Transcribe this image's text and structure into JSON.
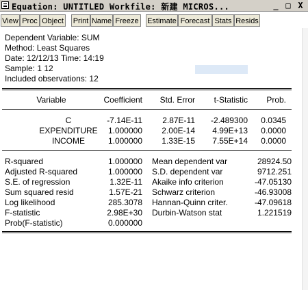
{
  "window": {
    "title": "Equation: UNTITLED   Workfile: 新建 MICROS...",
    "minimize": "_",
    "maximize": "□",
    "close": "X"
  },
  "toolbar": {
    "buttons": [
      "View",
      "Proc",
      "Object",
      "Print",
      "Name",
      "Freeze",
      "Estimate",
      "Forecast",
      "Stats",
      "Resids"
    ]
  },
  "header": {
    "dependent_variable": "Dependent Variable: SUM",
    "method": "Method: Least Squares",
    "date_time": "Date: 12/12/13   Time: 14:19",
    "sample": "Sample: 1 12",
    "observations": "Included observations: 12"
  },
  "coef_table": {
    "headers": [
      "Variable",
      "Coefficient",
      "Std. Error",
      "t-Statistic",
      "Prob."
    ],
    "rows": [
      [
        "C",
        "-7.14E-11",
        "2.87E-11",
        "-2.489300",
        "0.0345"
      ],
      [
        "EXPENDITURE",
        "1.000000",
        "2.00E-14",
        "4.99E+13",
        "0.0000"
      ],
      [
        "INCOME",
        "1.000000",
        "1.33E-15",
        "7.55E+14",
        "0.0000"
      ]
    ]
  },
  "stats": {
    "left": [
      [
        "R-squared",
        "1.000000"
      ],
      [
        "Adjusted R-squared",
        "1.000000"
      ],
      [
        "S.E. of regression",
        "1.32E-11"
      ],
      [
        "Sum squared resid",
        "1.57E-21"
      ],
      [
        "Log likelihood",
        "285.3078"
      ],
      [
        "F-statistic",
        "2.98E+30"
      ],
      [
        "Prob(F-statistic)",
        "0.000000"
      ]
    ],
    "right": [
      [
        "Mean dependent var",
        "28924.50"
      ],
      [
        "S.D. dependent var",
        "9712.251"
      ],
      [
        "Akaike info criterion",
        "-47.05130"
      ],
      [
        "Schwarz criterion",
        "-46.93008"
      ],
      [
        "Hannan-Quinn criter.",
        "-47.09618"
      ],
      [
        "Durbin-Watson stat",
        "1.221519"
      ]
    ]
  }
}
